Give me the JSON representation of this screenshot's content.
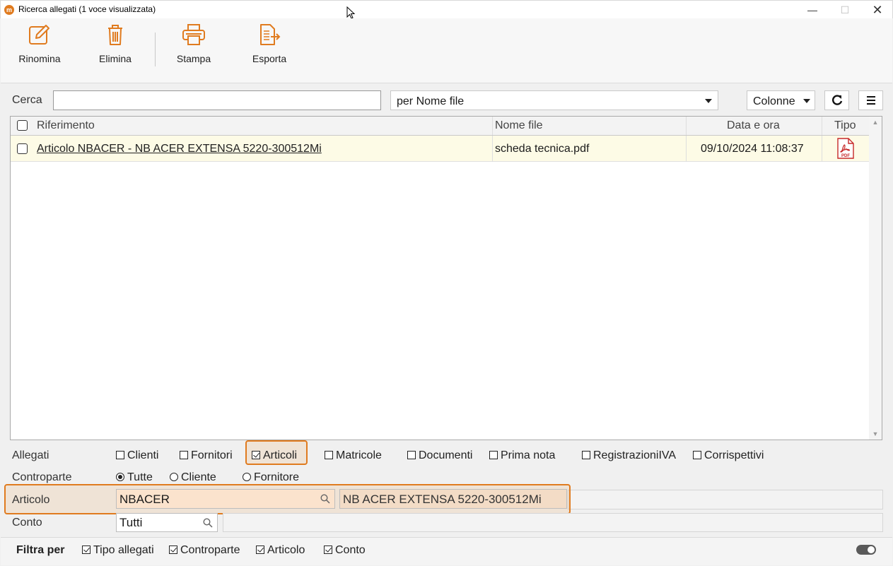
{
  "window": {
    "title": "Ricerca allegati (1 voce visualizzata)",
    "app_icon_glyph": "m",
    "minimize_glyph": "—",
    "maximize_glyph": "☐",
    "close_glyph": "✕"
  },
  "theme": {
    "accent": "#e07b1f",
    "row_highlight": "#fdfbe6"
  },
  "toolbar": {
    "rename_label": "Rinomina",
    "delete_label": "Elimina",
    "print_label": "Stampa",
    "export_label": "Esporta"
  },
  "search": {
    "label": "Cerca",
    "value": "",
    "mode_value": "per Nome file",
    "columns_label": "Colonne"
  },
  "table": {
    "headers": {
      "reference": "Riferimento",
      "filename": "Nome file",
      "datetime": "Data e ora",
      "type": "Tipo"
    },
    "rows": [
      {
        "reference": "Articolo NBACER - NB ACER EXTENSA 5220-300512Mi",
        "filename": "scheda tecnica.pdf",
        "datetime": "09/10/2024 11:08:37",
        "type_icon": "pdf-file-icon",
        "type_badge": "PDF"
      }
    ]
  },
  "filters": {
    "attachments_label": "Allegati",
    "attachments": {
      "clienti": "Clienti",
      "fornitori": "Fornitori",
      "articoli": "Articoli",
      "matricole": "Matricole",
      "documenti": "Documenti",
      "prima_nota": "Prima nota",
      "registrazioni_iva": "RegistrazioniIVA",
      "corrispettivi": "Corrispettivi"
    },
    "articoli_checked": true,
    "counterpart_label": "Controparte",
    "counterpart": {
      "tutte": "Tutte",
      "cliente": "Cliente",
      "fornitore": "Fornitore"
    },
    "counterpart_selected": "Tutte",
    "article_label": "Articolo",
    "article_code": "NBACER",
    "article_description": "NB ACER EXTENSA 5220-300512Mi",
    "account_label": "Conto",
    "account_value": "Tutti"
  },
  "filter_by": {
    "label": "Filtra per",
    "tipo_allegati": "Tipo allegati",
    "controparte": "Controparte",
    "articolo": "Articolo",
    "conto": "Conto"
  }
}
